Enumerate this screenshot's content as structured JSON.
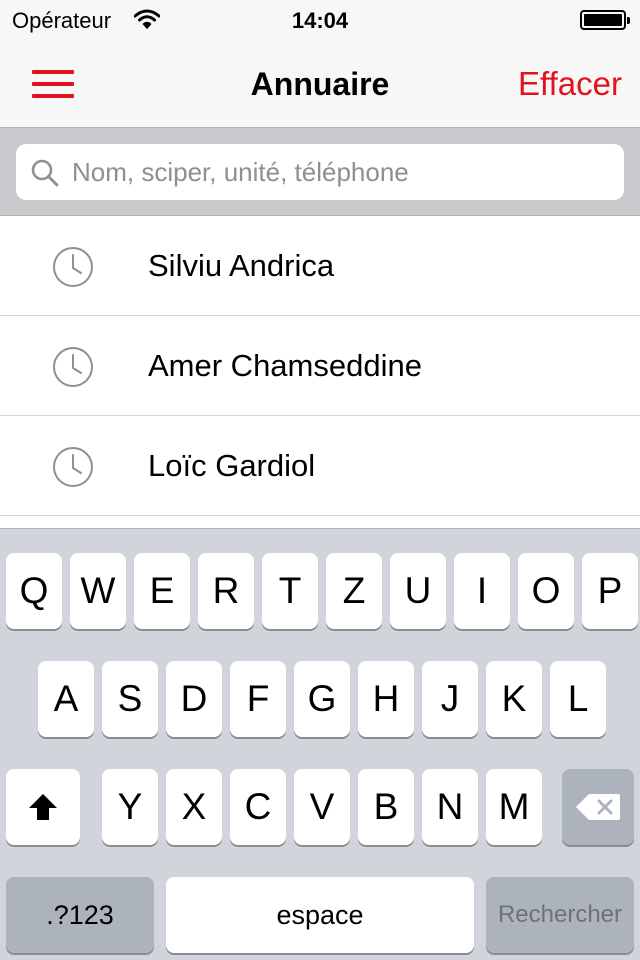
{
  "status_bar": {
    "carrier": "Opérateur",
    "time": "14:04",
    "battery_level": 1.0
  },
  "nav": {
    "title": "Annuaire",
    "clear_label": "Effacer",
    "menu_icon": "hamburger-menu-icon",
    "accent_color": "#e0141e"
  },
  "search": {
    "placeholder": "Nom, sciper, unité, téléphone",
    "value": "",
    "icon": "search-icon"
  },
  "history": {
    "icon": "clock-icon",
    "items": [
      {
        "label": "Silviu Andrica"
      },
      {
        "label": "Amer Chamseddine"
      },
      {
        "label": "Loïc Gardiol"
      }
    ]
  },
  "keyboard": {
    "row1": [
      "Q",
      "W",
      "E",
      "R",
      "T",
      "Z",
      "U",
      "I",
      "O",
      "P"
    ],
    "row2": [
      "A",
      "S",
      "D",
      "F",
      "G",
      "H",
      "J",
      "K",
      "L"
    ],
    "row3": [
      "Y",
      "X",
      "C",
      "V",
      "B",
      "N",
      "M"
    ],
    "shift_icon": "shift-arrow-icon",
    "backspace_icon": "backspace-icon",
    "numbers_label": ".?123",
    "space_label": "espace",
    "return_label": "Rechercher"
  }
}
